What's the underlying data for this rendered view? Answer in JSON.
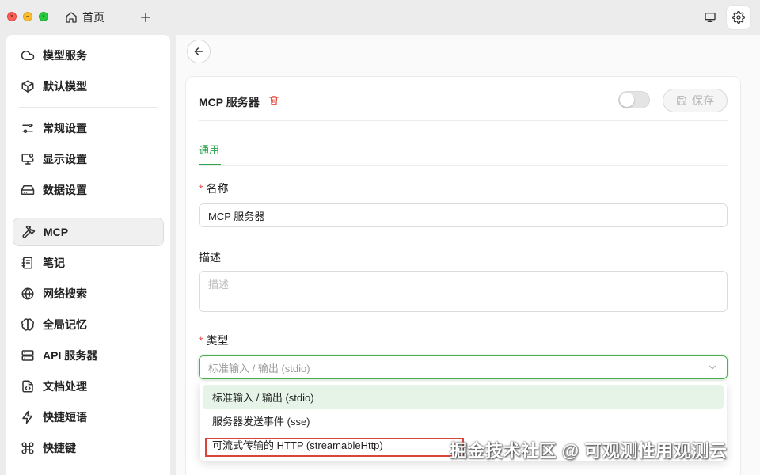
{
  "titlebar": {
    "tab_home_label": "首页"
  },
  "sidebar": {
    "groups": [
      [
        {
          "label": "模型服务",
          "icon": "cloud-icon"
        },
        {
          "label": "默认模型",
          "icon": "cube-icon"
        }
      ],
      [
        {
          "label": "常规设置",
          "icon": "sliders-icon"
        },
        {
          "label": "显示设置",
          "icon": "monitor-settings-icon"
        },
        {
          "label": "数据设置",
          "icon": "hard-drive-icon"
        }
      ],
      [
        {
          "label": "MCP",
          "icon": "hammer-icon",
          "active": true
        },
        {
          "label": "笔记",
          "icon": "notebook-icon"
        },
        {
          "label": "网络搜索",
          "icon": "globe-icon"
        },
        {
          "label": "全局记忆",
          "icon": "brain-icon"
        },
        {
          "label": "API 服务器",
          "icon": "server-icon"
        },
        {
          "label": "文档处理",
          "icon": "file-code-icon"
        },
        {
          "label": "快捷短语",
          "icon": "zap-icon"
        },
        {
          "label": "快捷键",
          "icon": "command-icon"
        }
      ]
    ]
  },
  "card": {
    "title": "MCP 服务器",
    "save_label": "保存",
    "enabled": false,
    "tab_label": "通用",
    "fields": {
      "name": {
        "label": "名称",
        "required": true,
        "value": "MCP 服务器"
      },
      "description": {
        "label": "描述",
        "required": false,
        "placeholder": "描述"
      },
      "type": {
        "label": "类型",
        "required": true,
        "placeholder": "标准输入 / 输出 (stdio)"
      }
    }
  },
  "dropdown": {
    "options": [
      "标准输入 / 输出 (stdio)",
      "服务器发送事件 (sse)",
      "可流式传输的 HTTP (streamableHttp)"
    ],
    "selected_index": 0,
    "highlighted_index": 2
  },
  "watermark": "掘金技术社区 @ 可观测性用观测云",
  "colors": {
    "accent": "#2ea44f",
    "required": "#e54d42",
    "highlight_box": "#d9453a"
  }
}
